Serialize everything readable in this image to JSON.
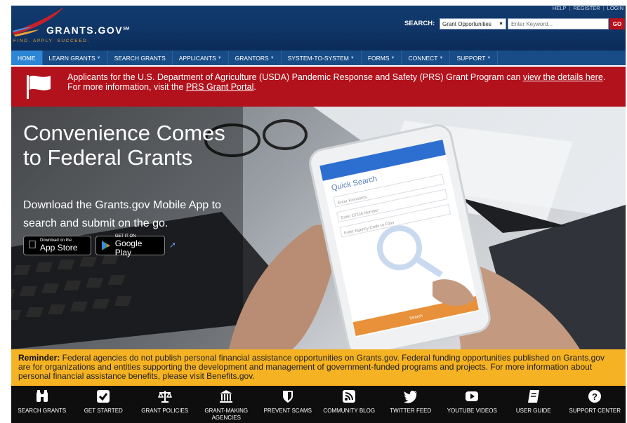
{
  "header": {
    "logo_text": "GRANTS.GOV",
    "logo_sm": "SM",
    "tagline": "FIND. APPLY. SUCCEED.",
    "top_links": [
      "HELP",
      "REGISTER",
      "LOGIN"
    ],
    "search_label": "SEARCH:",
    "search_select": "Grant Opportunities",
    "search_placeholder": "Enter Keyword...",
    "go_label": "GO"
  },
  "nav": {
    "items": [
      {
        "label": "HOME"
      },
      {
        "label": "LEARN GRANTS"
      },
      {
        "label": "SEARCH GRANTS"
      },
      {
        "label": "APPLICANTS"
      },
      {
        "label": "GRANTORS"
      },
      {
        "label": "SYSTEM-TO-SYSTEM"
      },
      {
        "label": "FORMS"
      },
      {
        "label": "CONNECT"
      },
      {
        "label": "SUPPORT"
      }
    ]
  },
  "alert": {
    "text1": "Applicants for the U.S. Department of Agriculture (USDA) Pandemic Response and Safety (PRS) Grant Program can ",
    "link1": "view the details here",
    "text2": ". For more information, visit the ",
    "link2": "PRS Grant Portal",
    "text3": "."
  },
  "hero": {
    "title": "Convenience Comes to Federal Grants",
    "subtitle": "Download the Grants.gov Mobile App to search and submit on the go.",
    "appstore_small": "Download on the",
    "appstore_big": "App Store",
    "googleplay_small": "GET IT ON",
    "googleplay_big": "Google Play",
    "phone_quick_search": "Quick Search",
    "phone_field1": "Enter Keywords",
    "phone_field2": "Enter CFDA Number",
    "phone_field3": "Enter Agency Code to Filter",
    "phone_button": "Search"
  },
  "reminder": {
    "bold": "Reminder:",
    "text": " Federal agencies do not publish personal financial assistance opportunities on Grants.gov. Federal funding opportunities published on Grants.gov are for organizations and entities supporting the development and management of government-funded programs and projects. For more information about personal financial assistance benefits, please visit Benefits.gov."
  },
  "footer": {
    "items": [
      {
        "label": "SEARCH GRANTS",
        "icon": "binoculars-icon"
      },
      {
        "label": "GET STARTED",
        "icon": "checkbox-icon"
      },
      {
        "label": "GRANT POLICIES",
        "icon": "scales-icon"
      },
      {
        "label": "GRANT-MAKING AGENCIES",
        "icon": "building-icon"
      },
      {
        "label": "PREVENT SCAMS",
        "icon": "shield-icon"
      },
      {
        "label": "COMMUNITY BLOG",
        "icon": "rss-icon"
      },
      {
        "label": "TWITTER FEED",
        "icon": "twitter-icon"
      },
      {
        "label": "YOUTUBE VIDEOS",
        "icon": "youtube-icon"
      },
      {
        "label": "USER GUIDE",
        "icon": "book-icon"
      },
      {
        "label": "SUPPORT CENTER",
        "icon": "question-icon"
      }
    ]
  },
  "colors": {
    "header_bg": "#123b6e",
    "nav_active": "#2d86d5",
    "alert_bg": "#b2121c",
    "reminder_bg": "#f5b223",
    "footer_bg": "#0e0e0e",
    "go_button": "#b8101c"
  }
}
